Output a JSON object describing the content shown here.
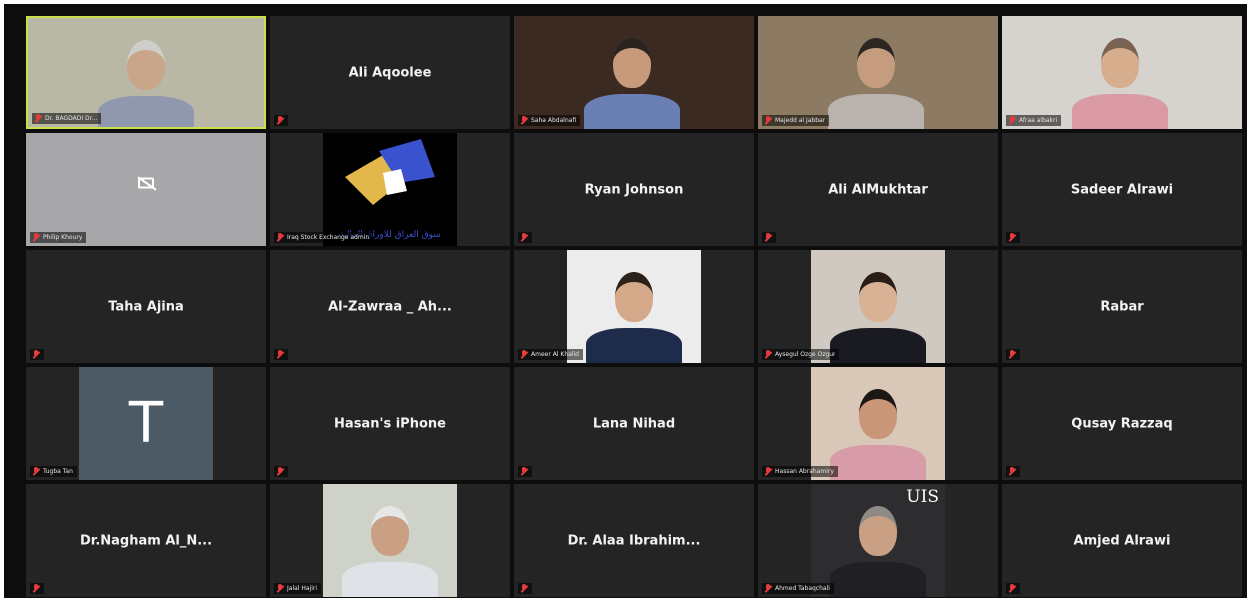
{
  "participants": [
    {
      "display": "video",
      "tag": "Dr. BAGDADI Dr...",
      "photo": {
        "bg": "#b9b7a6",
        "skin": "#c9a68a",
        "shirt": "#8f98ad",
        "hair": "#cfcfc9"
      }
    },
    {
      "display": "name",
      "name": "Ali Aqoolee"
    },
    {
      "display": "video",
      "tag": "Saha Abdalnafi",
      "photo": {
        "bg": "#3a2a22",
        "skin": "#c79a7b",
        "shirt": "#6a7fb4",
        "hair": "#2a2420"
      }
    },
    {
      "display": "video",
      "tag": "Majedd al Jabbar",
      "photo": {
        "bg": "#8c7a62",
        "skin": "#c59c7d",
        "shirt": "#b8b4ad",
        "hair": "#2b2622"
      }
    },
    {
      "display": "video",
      "tag": "Afraa albakri",
      "photo": {
        "bg": "#d6d2cd",
        "skin": "#d6ad8d",
        "shirt": "#d99aa3",
        "hair": "#7a6250"
      }
    },
    {
      "display": "camoff",
      "tag": "Philip Khoury"
    },
    {
      "display": "logo",
      "tag": "Iraq Stock Exchange admin",
      "logo_text": "سوق العراق للاوراق المالية"
    },
    {
      "display": "name",
      "name": "Ryan Johnson"
    },
    {
      "display": "name",
      "name": "Ali AlMukhtar"
    },
    {
      "display": "name",
      "name": "Sadeer Alrawi"
    },
    {
      "display": "name",
      "name": "Taha Ajina"
    },
    {
      "display": "name",
      "name": "Al-Zawraa _ Ah..."
    },
    {
      "display": "portrait",
      "tag": "Ameer Al Khalid",
      "photo": {
        "bg": "#ececec",
        "skin": "#d4a989",
        "shirt": "#1f2b4a",
        "hair": "#2a211b"
      }
    },
    {
      "display": "portrait",
      "tag": "Aysegul Ozge Ozgur",
      "photo": {
        "bg": "#cfc9c2",
        "skin": "#d9b296",
        "shirt": "#1a1a22",
        "hair": "#2a1c16"
      }
    },
    {
      "display": "name",
      "name": "Rabar"
    },
    {
      "display": "avatar",
      "letter": "T",
      "tag": "Tugba Tan"
    },
    {
      "display": "name",
      "name": "Hasan's iPhone"
    },
    {
      "display": "name",
      "name": "Lana Nihad"
    },
    {
      "display": "portrait",
      "tag": "Hassan Abrahamiry",
      "photo": {
        "bg": "#d9c8b8",
        "skin": "#c99778",
        "shirt": "#d79ca8",
        "hair": "#1d1714"
      }
    },
    {
      "display": "name",
      "name": "Qusay Razzaq"
    },
    {
      "display": "name",
      "name": "Dr.Nagham  Al_N..."
    },
    {
      "display": "portrait",
      "tag": "Jalal Hajiri",
      "photo": {
        "bg": "#cfd2c8",
        "skin": "#c9a084",
        "shirt": "#dfe2e6",
        "hair": "#e6e6e6"
      }
    },
    {
      "display": "name",
      "name": "Dr.  Alaa  Ibrahim..."
    },
    {
      "display": "portrait",
      "tag": "Ahmed Tabaqchali",
      "uis": "UIS",
      "photo": {
        "bg": "#2d2d2f",
        "skin": "#c9a084",
        "shirt": "#202024",
        "hair": "#8e8a85"
      }
    },
    {
      "display": "name",
      "name": "Amjed Alrawi"
    }
  ],
  "colors": {
    "active_border": "#c9e04a",
    "muted_mic": "#e33b3b",
    "tile_bg": "#242424",
    "window_bg": "#0d0d0d"
  }
}
